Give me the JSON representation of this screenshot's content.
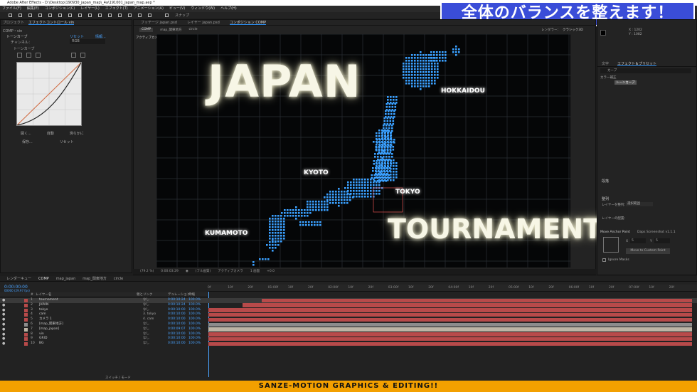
{
  "window": {
    "title": "Adobe After Effects - D:\\Desktop\\190930_japan_map\\_4a\\191001_japan_map.aep *"
  },
  "menu": [
    "ファイル(F)",
    "編集(E)",
    "コンポジション(C)",
    "レイヤー(L)",
    "エフェクト(T)",
    "アニメーション(A)",
    "ビュー(V)",
    "ウィンドウ(W)",
    "ヘルプ(H)"
  ],
  "toolbar": {
    "snap_label": "スナップ"
  },
  "banner": {
    "text": "全体のバランスを整えます！"
  },
  "left_panel": {
    "tabs": [
      "プロジェクト",
      "エフェクトコントロール vin"
    ],
    "comp_label": "COMP・vin",
    "effect_name": "トーンカーブ",
    "reset": "リセット",
    "info": "情報...",
    "channel_label": "チャンネル：",
    "channel_value": "RGB",
    "curve_label": "トーンカーブ",
    "buttons": [
      "開く...",
      "自動",
      "滑らかに",
      "保存...",
      "リセット"
    ]
  },
  "comp_viewer": {
    "tabs": [
      "フッテージ japan.psd",
      "レイヤー japan.psd",
      "コンポジション COMP"
    ],
    "subtabs": [
      "COMP",
      "map_関東地方",
      "circle"
    ],
    "renderer": "レンダラー：",
    "renderer_value": "クラシック3D",
    "active_camera": "アクティブカメラ",
    "title_text": "JAPAN",
    "subtitle_text": "TOURNAMENT",
    "cities": [
      "HOKKAIDOU",
      "KYOTO",
      "TOKYO",
      "KUMAMOTO"
    ],
    "controls": [
      "(79.2 %)",
      "0:00:03:29",
      "(フル画質)",
      "アクティブカメラ",
      "1 画面",
      "+0.0"
    ]
  },
  "right_panel": {
    "coords": [
      "X : 1202",
      "Y : 1082"
    ],
    "tabs": [
      "文字",
      "エフェクト＆プリセット"
    ],
    "search": "カーブ",
    "tree_item": "カラー補正",
    "tree_selected": "トーンカーブ",
    "section_para": "段落",
    "section_align": "整列",
    "align_to": "レイヤーを整列：",
    "align_target": "選択範囲",
    "distribute": "レイヤーの配置：",
    "anchor_title": "Move Anchor Point",
    "anchor_plugin": "Daps Screenshot v1.1.1",
    "anchor_x": "X",
    "anchor_y": "Y",
    "anchor_x_val": "5",
    "anchor_y_val": "5",
    "anchor_btn": "Move to Custom Point",
    "ignore_masks": "Ignore Masks"
  },
  "timeline": {
    "tabs": [
      "レンダーキュー",
      "COMP",
      "map_japan",
      "map_関東地方",
      "circle"
    ],
    "timecode": "0:00:00:00",
    "frame_info": "00000 (29.97 fps)",
    "col_headers": [
      "#",
      "レイヤー名",
      "親とリンク",
      "デュレーション",
      "伸縮"
    ],
    "ruler_ticks": [
      "0f",
      "10f",
      "20f",
      "01:00f",
      "10f",
      "20f",
      "02:00f",
      "10f",
      "20f",
      "03:00f",
      "10f",
      "20f",
      "04:00f",
      "10f",
      "20f",
      "05:00f",
      "10f",
      "20f",
      "06:00f",
      "10f",
      "20f",
      "07:00f",
      "10f",
      "20f"
    ],
    "footer_label": "スイッチ / モード",
    "layers": [
      {
        "num": "1",
        "name": "tournament",
        "parent": "なし",
        "dur": "0:00:10:24",
        "pct": "100.0%",
        "color": "#b84a4a",
        "start": 0.11,
        "selected": true
      },
      {
        "num": "2",
        "name": "JAPAN",
        "parent": "なし",
        "dur": "0:00:10:24",
        "pct": "100.0%",
        "color": "#b84a4a",
        "start": 0.07,
        "selected": false
      },
      {
        "num": "3",
        "name": "tokyo",
        "parent": "なし",
        "dur": "0:00:10:00",
        "pct": "100.0%",
        "color": "#b84a4a",
        "start": 0.0,
        "selected": false
      },
      {
        "num": "4",
        "name": "cam",
        "parent": "3. tokyo",
        "dur": "0:00:10:00",
        "pct": "100.0%",
        "color": "#b84a4a",
        "start": 0.0,
        "selected": false
      },
      {
        "num": "5",
        "name": "カメラ 1",
        "parent": "4. cam",
        "dur": "0:00:10:00",
        "pct": "100.0%",
        "color": "#b84a4a",
        "start": 0.0,
        "selected": false
      },
      {
        "num": "6",
        "name": "[map_関東地方]",
        "parent": "なし",
        "dur": "0:00:10:00",
        "pct": "100.0%",
        "color": "#8c8c8c",
        "start": 0.0,
        "selected": false
      },
      {
        "num": "7",
        "name": "[map_japan]",
        "parent": "なし",
        "dur": "0:00:09:07",
        "pct": "100.0%",
        "color": "#bcb4a5",
        "start": 0.0,
        "selected": false
      },
      {
        "num": "8",
        "name": "vin",
        "parent": "なし",
        "dur": "0:00:10:00",
        "pct": "100.0%",
        "color": "#b84a4a",
        "start": 0.0,
        "selected": false
      },
      {
        "num": "9",
        "name": "GRID",
        "parent": "なし",
        "dur": "0:00:10:00",
        "pct": "100.0%",
        "color": "#b84a4a",
        "start": 0.0,
        "selected": false
      },
      {
        "num": "10",
        "name": "BG",
        "parent": "なし",
        "dur": "0:00:10:00",
        "pct": "100.0%",
        "color": "#b84a4a",
        "start": 0.0,
        "selected": false
      }
    ]
  },
  "footer": {
    "text": "SANZE-MOTION GRAPHICS & EDITING!!"
  }
}
